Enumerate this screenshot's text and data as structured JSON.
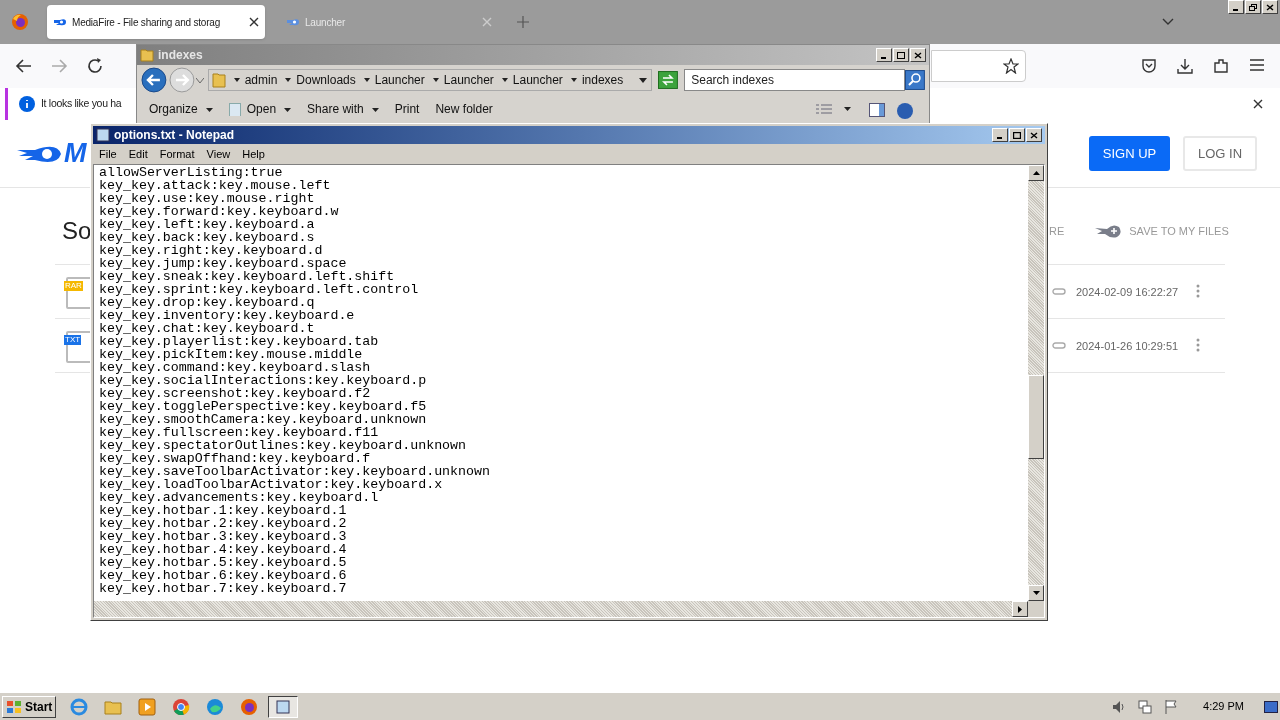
{
  "browser": {
    "tabs": [
      {
        "title": "MediaFire - File sharing and storag",
        "selected": true
      },
      {
        "title": "Launcher",
        "selected": false
      }
    ],
    "notification": "It looks like you ha",
    "page": {
      "logo": "M",
      "sign_up": "SIGN UP",
      "log_in": "LOG IN",
      "heading": "So",
      "share_action": "RE",
      "save_action": "SAVE TO MY FILES",
      "files": [
        {
          "badge": "RAR",
          "color": "#f5b800",
          "date": "2024-02-09 16:22:27"
        },
        {
          "badge": "TXT",
          "color": "#1a73e8",
          "date": "2024-01-26 10:29:51"
        }
      ]
    }
  },
  "explorer": {
    "title": "indexes",
    "breadcrumb": [
      "admin",
      "Downloads",
      "Launcher",
      "Launcher",
      "Launcher",
      "indexes"
    ],
    "search_placeholder": "Search indexes",
    "toolbar": [
      {
        "label": "Organize",
        "dropdown": true
      },
      {
        "label": "Open",
        "dropdown": true
      },
      {
        "label": "Share with",
        "dropdown": true
      },
      {
        "label": "Print",
        "dropdown": false
      },
      {
        "label": "New folder",
        "dropdown": false
      }
    ]
  },
  "notepad": {
    "title": "options.txt - Notepad",
    "menu": [
      "File",
      "Edit",
      "Format",
      "View",
      "Help"
    ],
    "lines": [
      "allowServerListing:true",
      "key_key.attack:key.mouse.left",
      "key_key.use:key.mouse.right",
      "key_key.forward:key.keyboard.w",
      "key_key.left:key.keyboard.a",
      "key_key.back:key.keyboard.s",
      "key_key.right:key.keyboard.d",
      "key_key.jump:key.keyboard.space",
      "key_key.sneak:key.keyboard.left.shift",
      "key_key.sprint:key.keyboard.left.control",
      "key_key.drop:key.keyboard.q",
      "key_key.inventory:key.keyboard.e",
      "key_key.chat:key.keyboard.t",
      "key_key.playerlist:key.keyboard.tab",
      "key_key.pickItem:key.mouse.middle",
      "key_key.command:key.keyboard.slash",
      "key_key.socialInteractions:key.keyboard.p",
      "key_key.screenshot:key.keyboard.f2",
      "key_key.togglePerspective:key.keyboard.f5",
      "key_key.smoothCamera:key.keyboard.unknown",
      "key_key.fullscreen:key.keyboard.f11",
      "key_key.spectatorOutlines:key.keyboard.unknown",
      "key_key.swapOffhand:key.keyboard.f",
      "key_key.saveToolbarActivator:key.keyboard.unknown",
      "key_key.loadToolbarActivator:key.keyboard.x",
      "key_key.advancements:key.keyboard.l",
      "key_key.hotbar.1:key.keyboard.1",
      "key_key.hotbar.2:key.keyboard.2",
      "key_key.hotbar.3:key.keyboard.3",
      "key_key.hotbar.4:key.keyboard.4",
      "key_key.hotbar.5:key.keyboard.5",
      "key_key.hotbar.6:key.keyboard.6",
      "key_key.hotbar.7:key.keyboard.7"
    ]
  },
  "taskbar": {
    "start": "Start",
    "clock": "4:29 PM"
  }
}
